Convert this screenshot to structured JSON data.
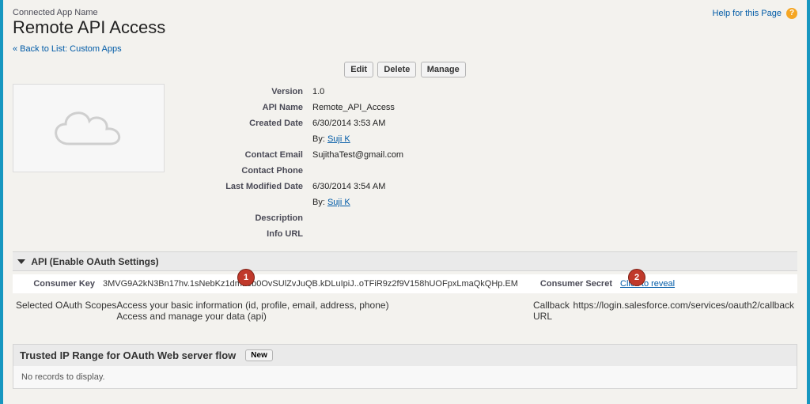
{
  "header": {
    "label": "Connected App Name",
    "title": "Remote API Access",
    "help_text": "Help for this Page"
  },
  "nav": {
    "back_text": "« Back to List: Custom Apps"
  },
  "buttons": {
    "edit": "Edit",
    "delete": "Delete",
    "manage": "Manage"
  },
  "detail": {
    "version_label": "Version",
    "version": "1.0",
    "api_name_label": "API Name",
    "api_name": "Remote_API_Access",
    "created_label": "Created Date",
    "created": "6/30/2014 3:53 AM",
    "created_by_prefix": "By:",
    "created_by": "Suji K",
    "contact_email_label": "Contact Email",
    "contact_email": "SujithaTest@gmail.com",
    "contact_phone_label": "Contact Phone",
    "contact_phone": "",
    "modified_label": "Last Modified Date",
    "modified": "6/30/2014 3:54 AM",
    "modified_by_prefix": "By:",
    "modified_by": "Suji K",
    "description_label": "Description",
    "description": "",
    "info_url_label": "Info URL",
    "info_url": ""
  },
  "api_section": {
    "title": "API (Enable OAuth Settings)",
    "consumer_key_label": "Consumer Key",
    "consumer_key": "3MVG9A2kN3Bn17hv.1sNebKz1dmtIeb0OvSUlZvJuQB.kDLuIpiJ..oTFiR9z2f9V158hUOFpxLmaQkQHp.EM",
    "consumer_secret_label": "Consumer Secret",
    "consumer_secret_action": "Click to reveal",
    "scopes_label": "Selected OAuth Scopes",
    "scopes_line1": "Access your basic information (id, profile, email, address, phone)",
    "scopes_line2": "Access and manage your data (api)",
    "callback_label": "Callback URL",
    "callback": "https://login.salesforce.com/services/oauth2/callback"
  },
  "trusted": {
    "title": "Trusted IP Range for OAuth Web server flow",
    "new": "New",
    "empty": "No records to display."
  },
  "annot": {
    "b1": "1",
    "b2": "2"
  }
}
